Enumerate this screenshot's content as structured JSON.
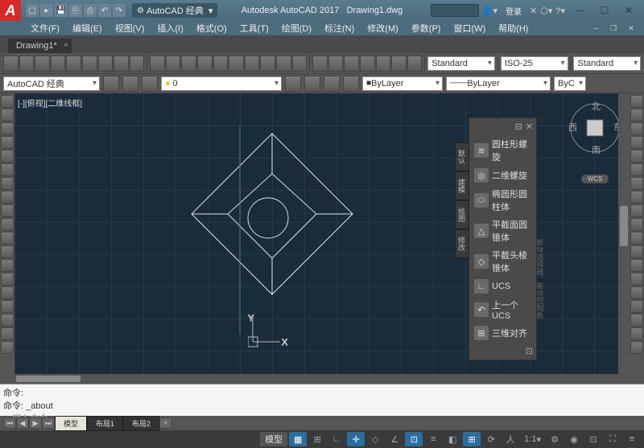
{
  "app": {
    "title_left": "Autodesk AutoCAD 2017",
    "title_right": "Drawing1.dwg"
  },
  "qat": [
    "new",
    "open",
    "save",
    "undo",
    "redo",
    "print",
    "more"
  ],
  "workspace": "AutoCAD 经典",
  "login": "登录",
  "menus": [
    "文件(F)",
    "编辑(E)",
    "视图(V)",
    "插入(I)",
    "格式(O)",
    "工具(T)",
    "绘图(D)",
    "标注(N)",
    "修改(M)",
    "参数(P)",
    "窗口(W)",
    "帮助(H)"
  ],
  "doc_tab": "Drawing1*",
  "props": {
    "workspace": "AutoCAD 经典",
    "layer_color": "",
    "linewidth": "0",
    "style1": "Standard",
    "style2": "ISO-25",
    "style3": "Standard",
    "bylayer1": "ByLayer",
    "bylayer2": "ByLayer",
    "bycm": "ByC"
  },
  "viewport_label": "[-][俯视][二维线框]",
  "side_tabs": [
    "默认",
    "建模",
    "绘图",
    "修改"
  ],
  "panel": {
    "items": [
      {
        "label": "圆柱形螺旋"
      },
      {
        "label": "二维螺旋"
      },
      {
        "label": "椭圆形圆柱体"
      },
      {
        "label": "平截面圆锥体"
      },
      {
        "label": "平截头棱锥体"
      },
      {
        "label": "UCS"
      },
      {
        "label": "上一个UCS"
      },
      {
        "label": "三维对齐"
      }
    ]
  },
  "nav": {
    "n": "北",
    "s": "南",
    "e": "东",
    "w": "西",
    "wcs": "WCS"
  },
  "cmd": {
    "line1": "命令:",
    "line2": "命令: _about",
    "prompt": "▸",
    "hint": "键入命令"
  },
  "layout_tabs": [
    "模型",
    "布局1",
    "布局2"
  ],
  "status": {
    "model": "模型",
    "scale": "1:1"
  },
  "gutter_text": "新块选择器。新块控制板"
}
